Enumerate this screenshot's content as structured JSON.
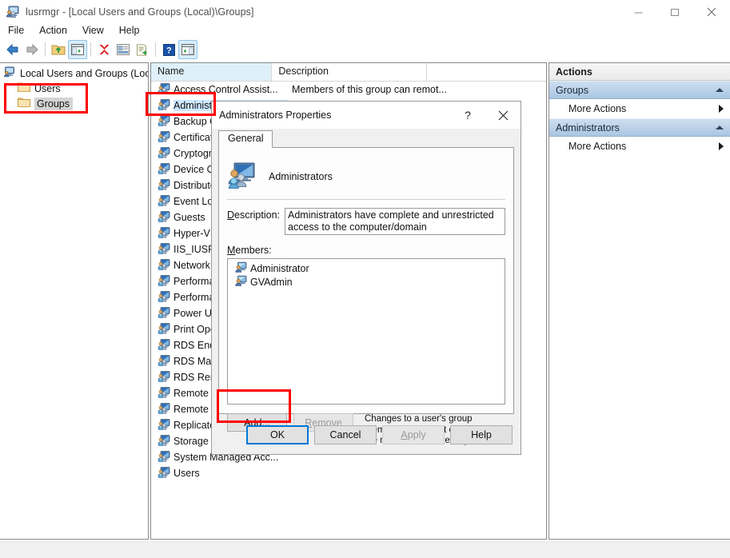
{
  "window": {
    "title": "lusrmgr - [Local Users and Groups (Local)\\Groups]",
    "icon": "computer-users-icon",
    "minimize": "—",
    "maximize": "□",
    "close": "✕"
  },
  "menubar": {
    "items": [
      "File",
      "Action",
      "View",
      "Help"
    ]
  },
  "toolbar": {
    "buttons": [
      {
        "name": "back-icon",
        "active": false
      },
      {
        "name": "forward-icon",
        "active": false
      },
      {
        "name": "up-folder-icon",
        "active": false
      },
      {
        "name": "show-hide-console-tree-icon",
        "active": true
      },
      {
        "name": "delete-icon",
        "active": false
      },
      {
        "name": "properties-icon",
        "active": false
      },
      {
        "name": "export-list-icon",
        "active": false
      },
      {
        "name": "help-icon",
        "active": false
      },
      {
        "name": "show-hide-action-pane-icon",
        "active": true
      }
    ]
  },
  "tree": {
    "root": {
      "label": "Local Users and Groups (Local)",
      "icon": "computer-icon"
    },
    "children": [
      {
        "label": "Users",
        "icon": "folder-icon",
        "selected": false
      },
      {
        "label": "Groups",
        "icon": "folder-icon",
        "selected": true
      }
    ]
  },
  "list": {
    "columns": [
      {
        "label": "Name",
        "sorted": true
      },
      {
        "label": "Description",
        "sorted": false
      },
      {
        "label": "",
        "sorted": false
      }
    ],
    "rows": [
      {
        "name": "Access Control Assist...",
        "description": "Members of this group can remot...",
        "selected": false
      },
      {
        "name": "Administrators",
        "description": "",
        "selected": true
      },
      {
        "name": "Backup Operators",
        "description": "",
        "selected": false
      },
      {
        "name": "Certificate Service DC...",
        "description": "",
        "selected": false
      },
      {
        "name": "Cryptographic Operat...",
        "description": "",
        "selected": false
      },
      {
        "name": "Device Owners",
        "description": "",
        "selected": false
      },
      {
        "name": "Distributed COM Users",
        "description": "",
        "selected": false
      },
      {
        "name": "Event Log Readers",
        "description": "",
        "selected": false
      },
      {
        "name": "Guests",
        "description": "",
        "selected": false
      },
      {
        "name": "Hyper-V Administrators",
        "description": "",
        "selected": false
      },
      {
        "name": "IIS_IUSRS",
        "description": "",
        "selected": false
      },
      {
        "name": "Network Configuratio...",
        "description": "",
        "selected": false
      },
      {
        "name": "Performance Log Users",
        "description": "",
        "selected": false
      },
      {
        "name": "Performance Monitor...",
        "description": "",
        "selected": false
      },
      {
        "name": "Power Users",
        "description": "",
        "selected": false
      },
      {
        "name": "Print Operators",
        "description": "",
        "selected": false
      },
      {
        "name": "RDS Endpoint Servers",
        "description": "",
        "selected": false
      },
      {
        "name": "RDS Management Ser...",
        "description": "",
        "selected": false
      },
      {
        "name": "RDS Remote Access S...",
        "description": "",
        "selected": false
      },
      {
        "name": "Remote Desktop Users",
        "description": "",
        "selected": false
      },
      {
        "name": "Remote Management...",
        "description": "",
        "selected": false
      },
      {
        "name": "Replicator",
        "description": "",
        "selected": false
      },
      {
        "name": "Storage Replica Admi...",
        "description": "",
        "selected": false
      },
      {
        "name": "System Managed Acc...",
        "description": "",
        "selected": false
      },
      {
        "name": "Users",
        "description": "",
        "selected": false
      }
    ]
  },
  "actions": {
    "title": "Actions",
    "sections": [
      {
        "header": "Groups",
        "items": [
          {
            "label": "More Actions"
          }
        ]
      },
      {
        "header": "Administrators",
        "items": [
          {
            "label": "More Actions"
          }
        ]
      }
    ]
  },
  "dialog": {
    "title": "Administrators Properties",
    "help_button": "?",
    "close_button": "✕",
    "tabs": [
      {
        "label": "General",
        "active": true
      }
    ],
    "group_name": "Administrators",
    "group_icon": "group-large-icon",
    "description_label": "Description:",
    "description_value": "Administrators have complete and unrestricted access to the computer/domain",
    "members_label": "Members:",
    "members": [
      {
        "name": "Administrator",
        "icon": "user-icon"
      },
      {
        "name": "GVAdmin",
        "icon": "user-icon"
      }
    ],
    "add_button": "Add...",
    "remove_button": "Remove",
    "remove_disabled": true,
    "note": "Changes to a user's group membership are not effective until the next time the user logs on.",
    "footer_buttons": [
      {
        "label": "OK",
        "default": true,
        "disabled": false
      },
      {
        "label": "Cancel",
        "default": false,
        "disabled": false
      },
      {
        "label": "Apply",
        "default": false,
        "disabled": true
      },
      {
        "label": "Help",
        "default": false,
        "disabled": false
      }
    ]
  },
  "annotations": {
    "color": "#ff0000",
    "boxes": [
      {
        "name": "highlight-groups-tree-item"
      },
      {
        "name": "highlight-administrators-row"
      },
      {
        "name": "highlight-add-button"
      }
    ]
  }
}
